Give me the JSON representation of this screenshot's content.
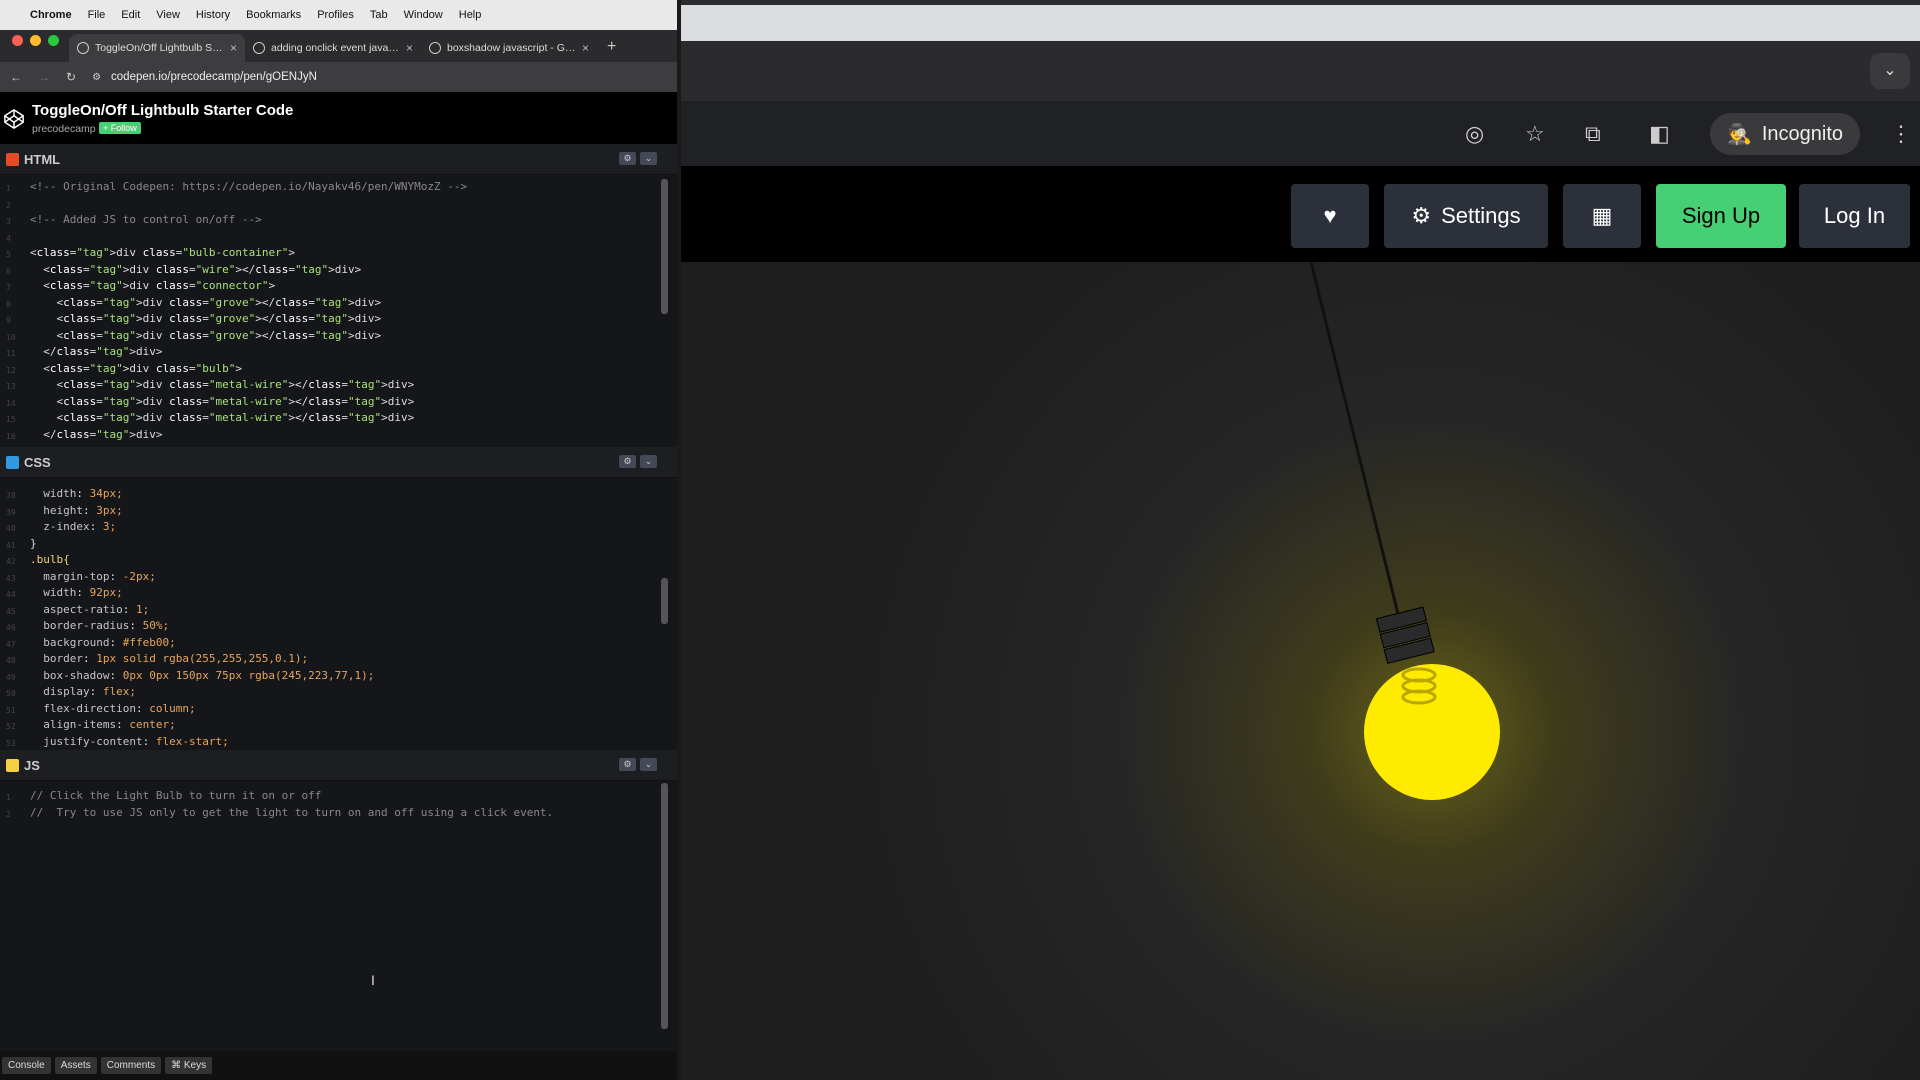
{
  "menubar": {
    "app": "Chrome",
    "items": [
      "File",
      "Edit",
      "View",
      "History",
      "Bookmarks",
      "Profiles",
      "Tab",
      "Window",
      "Help"
    ]
  },
  "tabs": [
    {
      "title": "ToggleOn/Off Lightbulb Starter Code",
      "active": true
    },
    {
      "title": "adding onclick event javascript",
      "active": false
    },
    {
      "title": "boxshadow javascript - Google Search",
      "active": false
    }
  ],
  "address": {
    "url": "codepen.io/precodecamp/pen/gOENJyN"
  },
  "pen": {
    "title": "ToggleOn/Off Lightbulb Starter Code",
    "user": "precodecamp",
    "follow": "+ Follow"
  },
  "editors": {
    "html": {
      "label": "HTML",
      "badge_color": "#e34c26"
    },
    "css": {
      "label": "CSS",
      "badge_color": "#2f9ae0"
    },
    "js": {
      "label": "JS",
      "badge_color": "#f5d042"
    }
  },
  "html_lines": [
    {
      "n": "1",
      "t": "<!-- Original Codepen: https://codepen.io/Nayakv46/pen/WNYMozZ -->"
    },
    {
      "n": "2",
      "t": ""
    },
    {
      "n": "3",
      "t": "<!-- Added JS to control on/off -->"
    },
    {
      "n": "4",
      "t": ""
    },
    {
      "n": "5",
      "t": "<div class=\"bulb-container\">"
    },
    {
      "n": "6",
      "t": "  <div class=\"wire\"></div>"
    },
    {
      "n": "7",
      "t": "  <div class=\"connector\">"
    },
    {
      "n": "8",
      "t": "    <div class=\"grove\"></div>"
    },
    {
      "n": "9",
      "t": "    <div class=\"grove\"></div>"
    },
    {
      "n": "10",
      "t": "    <div class=\"grove\"></div>"
    },
    {
      "n": "11",
      "t": "  </div>"
    },
    {
      "n": "12",
      "t": "  <div class=\"bulb\">"
    },
    {
      "n": "13",
      "t": "    <div class=\"metal-wire\"></div>"
    },
    {
      "n": "14",
      "t": "    <div class=\"metal-wire\"></div>"
    },
    {
      "n": "15",
      "t": "    <div class=\"metal-wire\"></div>"
    },
    {
      "n": "16",
      "t": "  </div>"
    }
  ],
  "css_lines": [
    {
      "n": "38",
      "t": "  width: 34px;"
    },
    {
      "n": "39",
      "t": "  height: 3px;"
    },
    {
      "n": "40",
      "t": "  z-index: 3;"
    },
    {
      "n": "41",
      "t": "}"
    },
    {
      "n": "42",
      "t": ".bulb{"
    },
    {
      "n": "43",
      "t": "  margin-top: -2px;"
    },
    {
      "n": "44",
      "t": "  width: 92px;"
    },
    {
      "n": "45",
      "t": "  aspect-ratio: 1;"
    },
    {
      "n": "46",
      "t": "  border-radius: 50%;"
    },
    {
      "n": "47",
      "t": "  background: #ffeb00;"
    },
    {
      "n": "48",
      "t": "  border: 1px solid rgba(255,255,255,0.1);"
    },
    {
      "n": "49",
      "t": "  box-shadow: 0px 0px 150px 75px rgba(245,223,77,1);"
    },
    {
      "n": "50",
      "t": "  display: flex;"
    },
    {
      "n": "51",
      "t": "  flex-direction: column;"
    },
    {
      "n": "52",
      "t": "  align-items: center;"
    },
    {
      "n": "53",
      "t": "  justify-content: flex-start;"
    }
  ],
  "js_lines": [
    {
      "n": "1",
      "t": "// Click the Light Bulb to turn it on or off"
    },
    {
      "n": "2",
      "t": "//  Try to use JS only to get the light to turn on and off using a click event."
    }
  ],
  "footer": [
    "Console",
    "Assets",
    "Comments",
    "⌘ Keys"
  ],
  "browser": {
    "incognito_label": "Incognito"
  },
  "codepen_nav": {
    "settings": "Settings",
    "signup": "Sign Up",
    "login": "Log In"
  },
  "bulb": {
    "state": "on",
    "color": "#ffeb00"
  }
}
